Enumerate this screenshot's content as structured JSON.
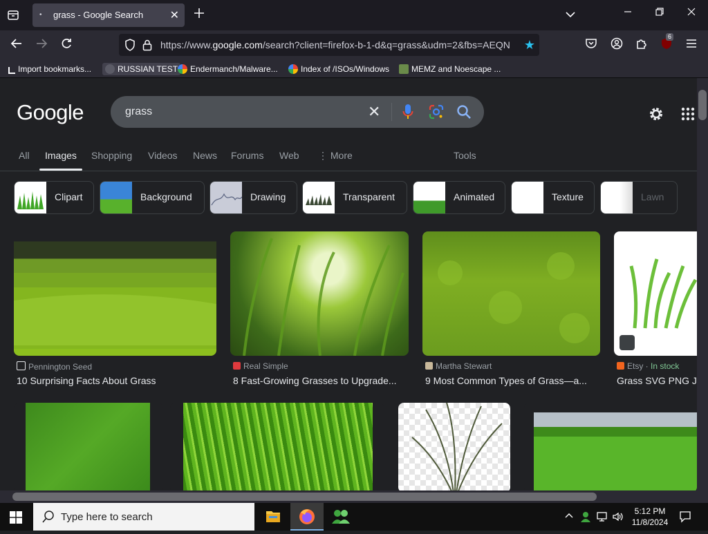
{
  "browser": {
    "tab_title": "grass - Google Search",
    "tab_favicon": "•",
    "url_domain_prefix": "https://www.",
    "url_domain": "google.com",
    "url_rest": "/search?client=firefox-b-1-d&q=grass&udm=2&fbs=AEQN",
    "account_badge": "6"
  },
  "bookmarks": [
    {
      "label": "Import bookmarks...",
      "icon": "import-icon"
    },
    {
      "label": "RUSSIAN TEST",
      "icon": "globe-icon"
    },
    {
      "label": "Endermanch/Malware...",
      "icon": "google-icon"
    },
    {
      "label": "Index of /ISOs/Windows",
      "icon": "google-icon"
    },
    {
      "label": "MEMZ and Noescape ...",
      "icon": "image-icon"
    }
  ],
  "google": {
    "logo": "Google",
    "query": "grass",
    "tabs": [
      "All",
      "Images",
      "Shopping",
      "Videos",
      "News",
      "Forums",
      "Web",
      "More",
      "Tools"
    ],
    "active_tab": "Images",
    "chips": [
      "Clipart",
      "Background",
      "Drawing",
      "Transparent",
      "Animated",
      "Texture",
      "Lawn"
    ],
    "results": [
      {
        "source": "Pennington Seed",
        "title": "10 Surprising Facts About Grass"
      },
      {
        "source": "Real Simple",
        "title": "8 Fast-Growing Grasses to Upgrade..."
      },
      {
        "source": "Martha Stewart",
        "title": "9 Most Common Types of Grass—a..."
      },
      {
        "source": "Etsy",
        "stock": "In stock",
        "title": "Grass SVG PNG J"
      }
    ]
  },
  "taskbar": {
    "search_placeholder": "Type here to search",
    "time": "5:12 PM",
    "date": "11/8/2024"
  },
  "colors": {
    "accent": "#8ab4f8",
    "page_bg": "#202124",
    "instock": "#81c995"
  }
}
